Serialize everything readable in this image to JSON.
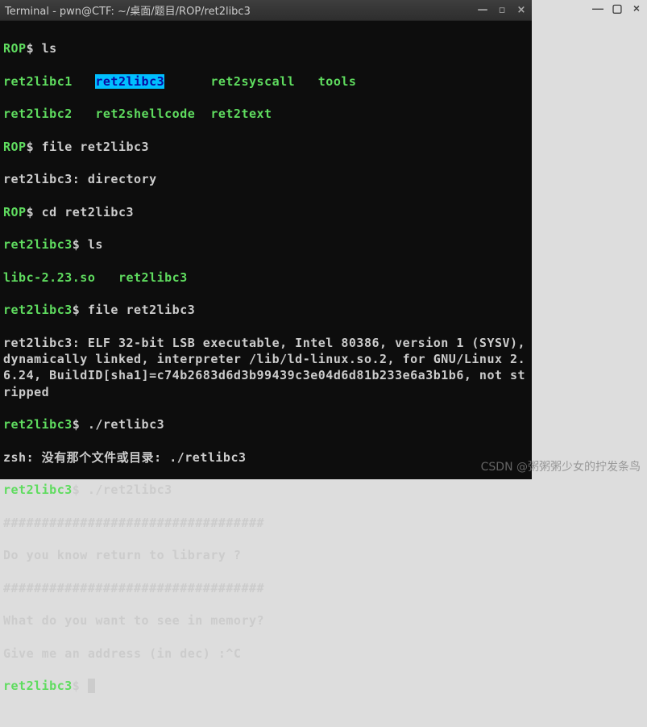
{
  "window": {
    "title": "Terminal - pwn@CTF: ~/桌面/题目/ROP/ret2libc3"
  },
  "outer_controls": {
    "min": "—",
    "max": "▢",
    "close": "×"
  },
  "win_controls": {
    "min": "—",
    "max": "▫",
    "close": "×"
  },
  "lines": {
    "l1_prompt": "ROP",
    "l1_dollar": "$ ",
    "l1_cmd": "ls",
    "ls1_a": "ret2libc1",
    "ls1_b": "ret2libc3",
    "ls1_c": "ret2syscall",
    "ls1_d": "tools",
    "ls2_a": "ret2libc2",
    "ls2_b": "ret2shellcode",
    "ls2_c": "ret2text",
    "l3_prompt": "ROP",
    "l3_cmd": "file ret2libc3",
    "l4": "ret2libc3: directory",
    "l5_prompt": "ROP",
    "l5_cmd": "cd ret2libc3",
    "l6_prompt": "ret2libc3",
    "l6_cmd": "ls",
    "ls3_a": "libc-2.23.so",
    "ls3_b": "ret2libc3",
    "l8_prompt": "ret2libc3",
    "l8_cmd": "file ret2libc3",
    "file_out1": "ret2libc3: ELF 32-bit LSB executable, Intel 80386, version 1 (SYSV), dy",
    "file_out1b": "nami",
    "file_out1c": "cally linked, interpreter /lib/ld-linux.so.2, for GNU/Linux 2.6.24, BuildID[sha1]=c74b2683d6d3b99439c3e04d6d81b233e6a3b1b6, not stripped",
    "l10_prompt": "ret2libc3",
    "l10_cmd": "./retlibc3",
    "zsh_err": "zsh: 没有那个文件或目录: ./retlibc3",
    "l12_prompt": "ret2libc3",
    "l12_cmd": "./ret2libc3",
    "hash1": "##################################",
    "banner": "Do you know return to library ?",
    "hash2": "##################################",
    "q1": "What do you want to see in memory?",
    "q2": "Give me an address (in dec) :^C",
    "last_prompt": "ret2libc3",
    "last_dollar": "$ "
  },
  "watermark": "CSDN @粥粥粥少女的拧发条鸟"
}
